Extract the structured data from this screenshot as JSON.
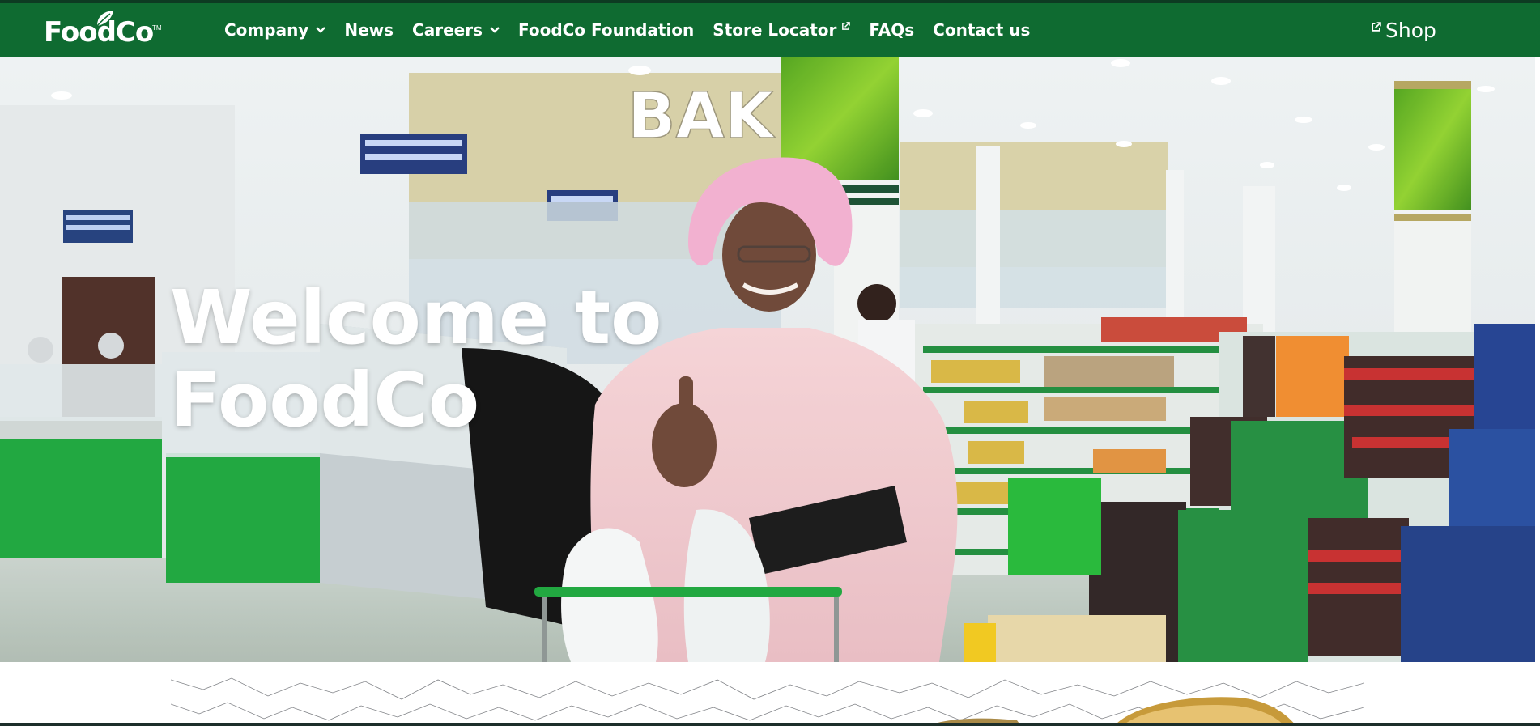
{
  "header": {
    "logo_text": "FoodCo",
    "logo_tm": "TM",
    "nav": [
      {
        "label": "Company",
        "has_dropdown": true,
        "external": false
      },
      {
        "label": "News",
        "has_dropdown": false,
        "external": false
      },
      {
        "label": "Careers",
        "has_dropdown": true,
        "external": false
      },
      {
        "label": "FoodCo Foundation",
        "has_dropdown": false,
        "external": false
      },
      {
        "label": "Store Locator",
        "has_dropdown": false,
        "external": true
      },
      {
        "label": "FAQs",
        "has_dropdown": false,
        "external": false
      },
      {
        "label": "Contact us",
        "has_dropdown": false,
        "external": false
      }
    ],
    "shop_label": "Shop"
  },
  "hero": {
    "title_line1": "Welcome to",
    "title_line2": "FoodCo",
    "sign_text": "BAK"
  },
  "colors": {
    "nav_bg": "#0f6b31",
    "nav_text": "#ffffff",
    "hero_title": "#ffffff",
    "accent_green": "#1aa53a"
  },
  "icons": {
    "dropdown": "chevron-down-icon",
    "external": "external-link-icon",
    "logo_leaf": "leaf-icon"
  }
}
